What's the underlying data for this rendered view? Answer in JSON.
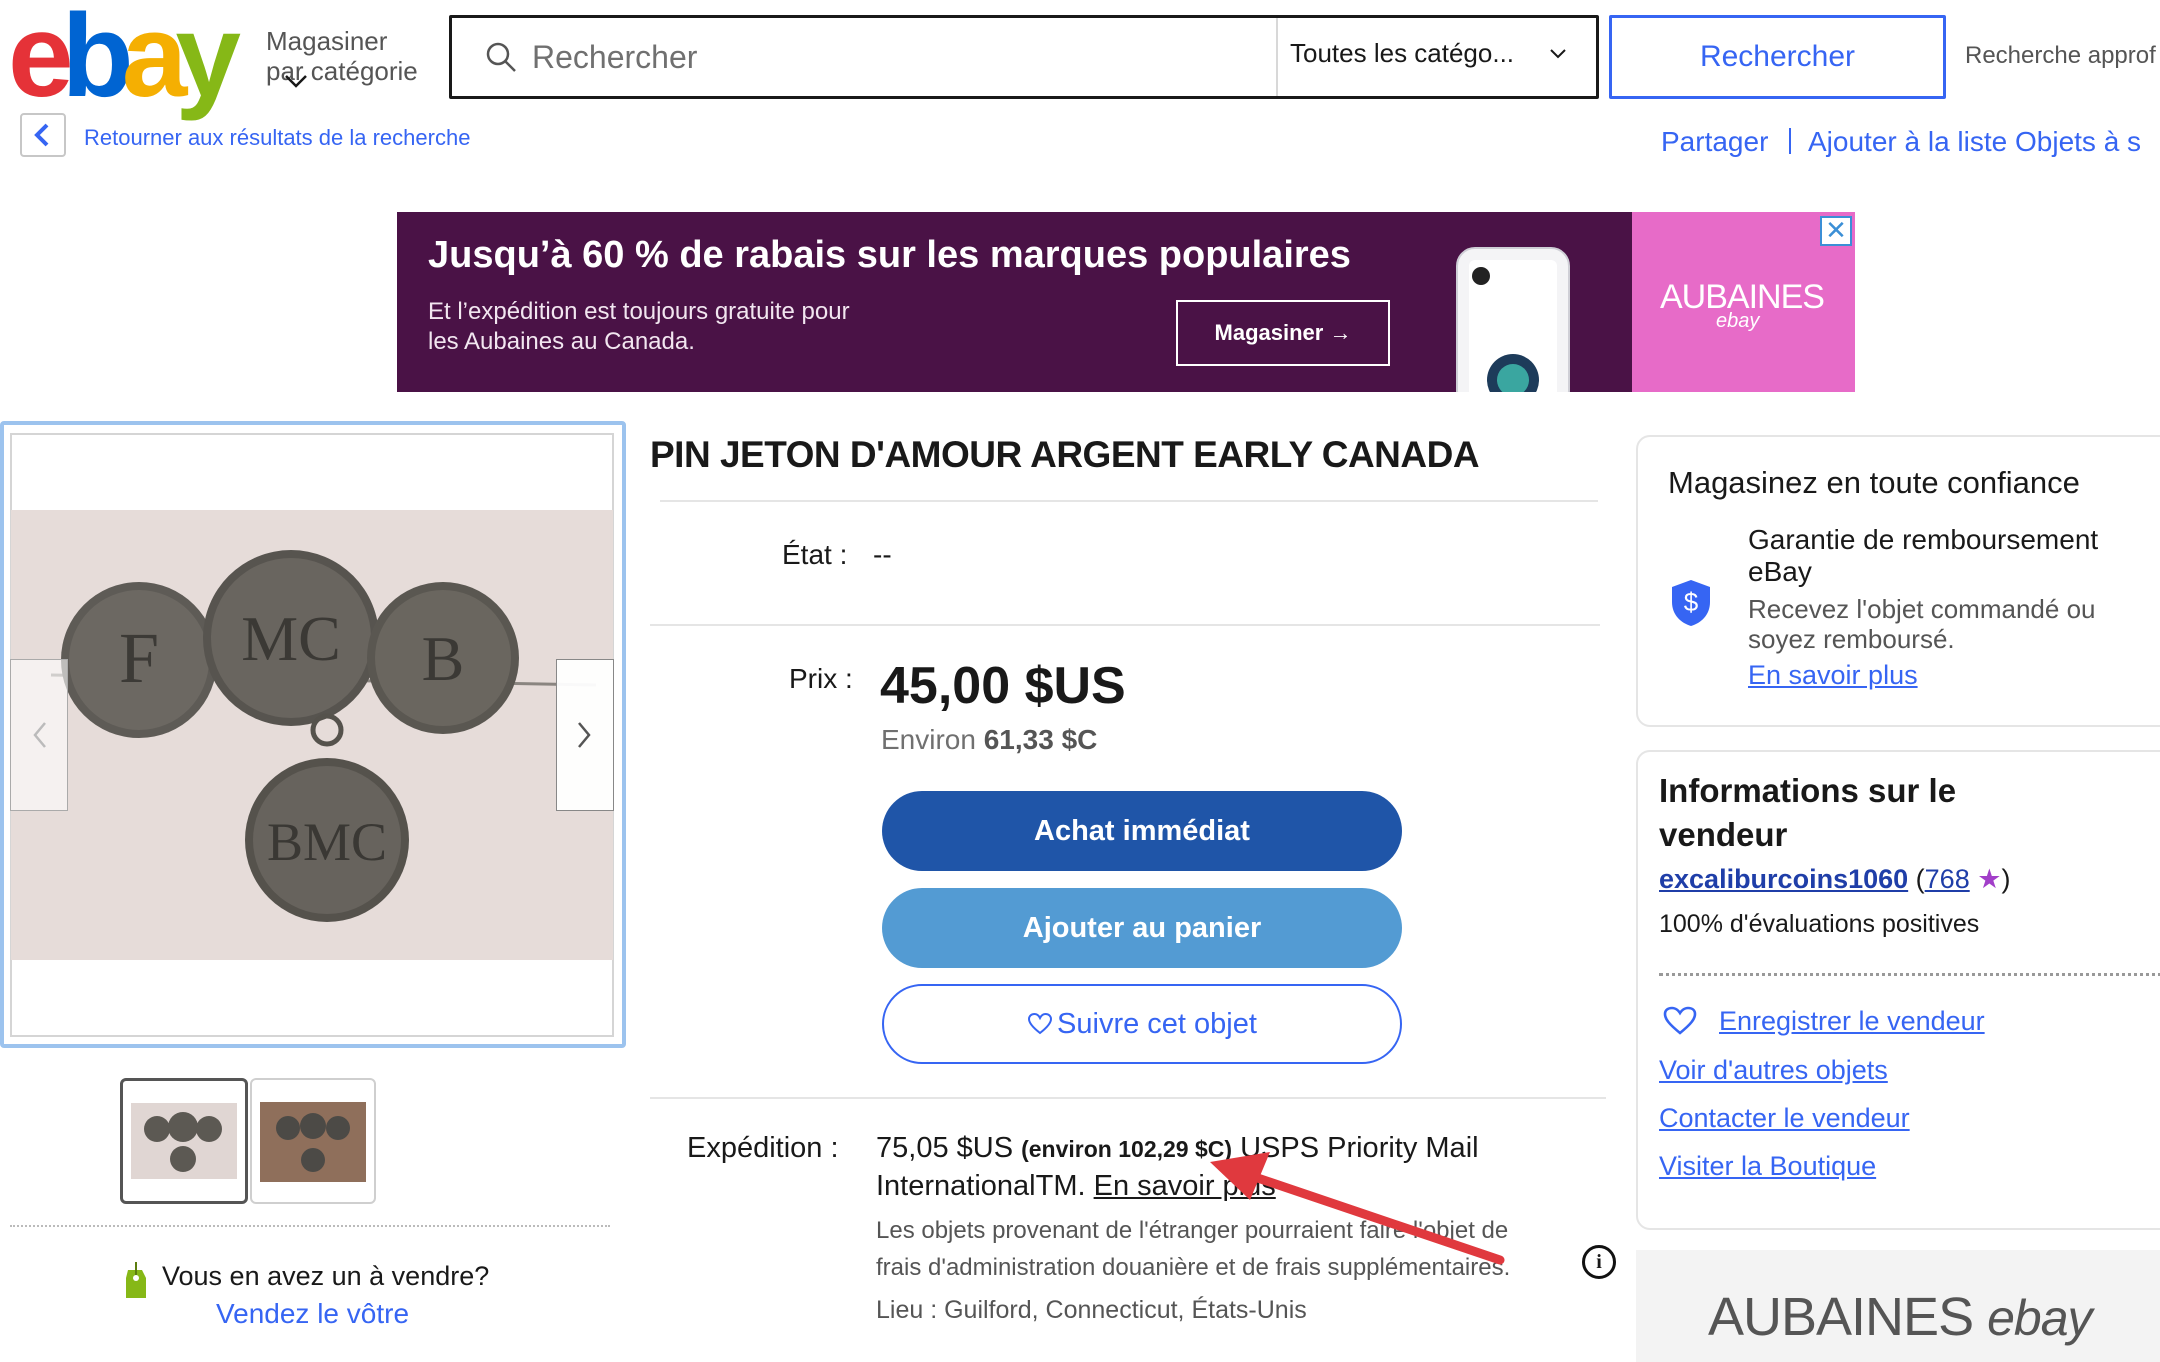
{
  "header": {
    "logo_letters": [
      "e",
      "b",
      "a",
      "y"
    ],
    "logo_colors": [
      "#e53238",
      "#0064d2",
      "#f5af02",
      "#86b817"
    ],
    "shop_by_category_1": "Magasiner",
    "shop_by_category_2": "par catégorie",
    "search_placeholder": "Rechercher",
    "category_select": "Toutes les catégo...",
    "search_button": "Rechercher",
    "advanced_search": "Recherche approf"
  },
  "subnav": {
    "back_to_results": "Retourner aux résultats de la recherche",
    "share": "Partager",
    "add_to_watchlist": "Ajouter à la liste Objets à s"
  },
  "banner": {
    "headline": "Jusqu’à 60 % de rabais sur les marques populaires",
    "sub_line_1": "Et l’expédition est toujours gratuite pour",
    "sub_line_2": "les Aubaines au Canada.",
    "cta": "Magasiner →",
    "brand": "AUBAINES",
    "brand_sub": "ebay",
    "close": "✕",
    "colors": {
      "background": "#4a1246",
      "accent": "#e76bc8"
    }
  },
  "gallery": {
    "prev": "‹",
    "next": "›",
    "thumbnails": [
      "thumb-1",
      "thumb-2"
    ],
    "sell_question": "Vous en avez un à vendre?",
    "sell_link": "Vendez le vôtre"
  },
  "item": {
    "title": "PIN JETON D'AMOUR ARGENT EARLY CANADA",
    "condition_label": "État :",
    "condition_value": "--",
    "price_label": "Prix :",
    "price": "45,00 $US",
    "approx_prefix": "Environ ",
    "approx_value": "61,33 $C",
    "buy_now": "Achat immédiat",
    "add_to_cart": "Ajouter au panier",
    "watch": "Suivre cet objet",
    "shipping_label": "Expédition :",
    "shipping_price": "75,05 $US",
    "shipping_converted": "(environ 102,29 $C)",
    "shipping_service_1": " USPS Priority Mail",
    "shipping_service_2": "InternationalTM. ",
    "shipping_learn_more": "En savoir plus",
    "shipping_note_1": "Les objets provenant de l'étranger pourraient faire l'objet de",
    "shipping_note_2": "frais d'administration douanière et de frais supplémentaires.",
    "location": "Lieu : Guilford, Connecticut, États-Unis",
    "info": "i"
  },
  "trust": {
    "title": "Magasinez en toute confiance",
    "guarantee_title_1": "Garantie de remboursement",
    "guarantee_title_2": "eBay",
    "guarantee_desc_1": "Recevez l'objet commandé ou",
    "guarantee_desc_2": "soyez remboursé.",
    "learn_more": "En savoir plus"
  },
  "seller": {
    "title_1": "Informations sur le",
    "title_2": "vendeur",
    "name": "excaliburcoins1060",
    "feedback_count": "768",
    "open_paren": " (",
    "close_paren": ")",
    "star": "★",
    "positive": "100% d'évaluations positives",
    "save_seller": "Enregistrer le vendeur",
    "other_items": "Voir d'autres objets",
    "contact": "Contacter le vendeur",
    "visit_store": "Visiter la Boutique"
  },
  "bottom_ad": {
    "text": "AUBAINES",
    "brand": "ebay"
  }
}
